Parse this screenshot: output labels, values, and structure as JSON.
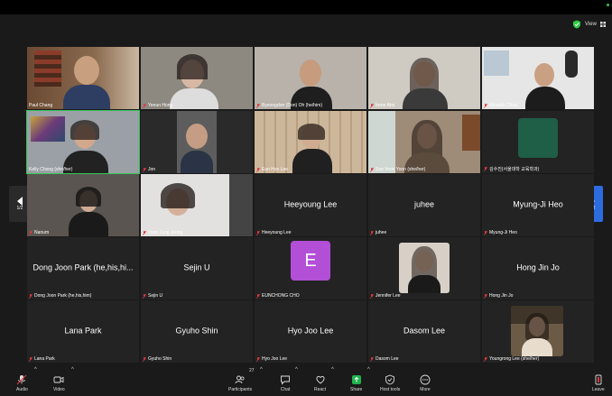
{
  "view": {
    "label": "View"
  },
  "pager": {
    "left": "1/2",
    "right": "1/2"
  },
  "tiles": [
    {
      "name": "Paul Chang"
    },
    {
      "name": "Yeeun Hong"
    },
    {
      "name": "Byeongdon (Don) Oh (he/him)"
    },
    {
      "name": "Irene Ahn"
    },
    {
      "name": "Hyunsik Chun"
    },
    {
      "name": "Kelly Chong (she/her)"
    },
    {
      "name": "Jon"
    },
    {
      "name": "Eun Hye Lee"
    },
    {
      "name": "Soo Yeon Yoon (she/her)"
    },
    {
      "name": "김수진(서울대학 교육학과)"
    },
    {
      "name": "Nanum"
    },
    {
      "name": "Yoon Jung Jeong"
    },
    {
      "name": "Heeyoung Lee",
      "big": "Heeyoung Lee"
    },
    {
      "name": "juhee",
      "big": "juhee"
    },
    {
      "name": "Myung-Ji Heo",
      "big": "Myung-Ji Heo"
    },
    {
      "name": "Dong Joon Park (he,his,him)",
      "big": "Dong Joon Park (he,his,hi..."
    },
    {
      "name": "Sejin U",
      "big": "Sejin U"
    },
    {
      "name": "EUNCHONG CHO",
      "letter": "E"
    },
    {
      "name": "Jennifer Lee"
    },
    {
      "name": "Hong Jin Jo",
      "big": "Hong Jin Jo"
    },
    {
      "name": "Lana Park",
      "big": "Lana Park"
    },
    {
      "name": "Gyuho Shin",
      "big": "Gyuho Shin"
    },
    {
      "name": "Hyo Joo Lee",
      "big": "Hyo Joo Lee"
    },
    {
      "name": "Dasom Lee",
      "big": "Dasom Lee"
    },
    {
      "name": "Youngrong Lee (she/her)"
    }
  ],
  "toolbar": {
    "audio": "Audio",
    "video": "Video",
    "participants": "Participants",
    "participants_count": "27",
    "chat": "Chat",
    "react": "React",
    "share": "Share",
    "host_tools": "Host tools",
    "more": "More",
    "leave": "Leave"
  },
  "colors": {
    "tile_bg": "#232323",
    "accent_green": "#34c759",
    "share_green": "#22b14c",
    "avatar_purple": "#b24fd6",
    "avatar_green": "#1f5e47",
    "pager_blue": "#2d6cdf",
    "muted_red": "#e0383e"
  }
}
